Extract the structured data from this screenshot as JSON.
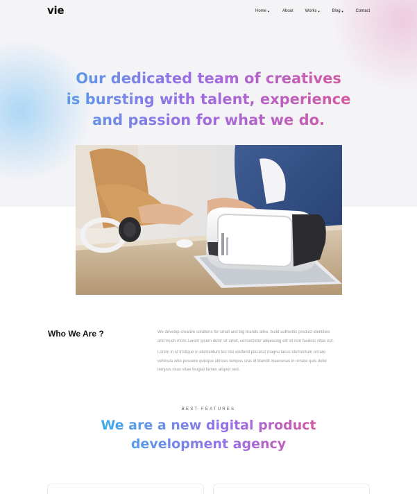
{
  "header": {
    "logo": "vie",
    "nav": [
      {
        "label": "Home",
        "has_dropdown": true
      },
      {
        "label": "About",
        "has_dropdown": false
      },
      {
        "label": "Works",
        "has_dropdown": true
      },
      {
        "label": "Blog",
        "has_dropdown": true
      },
      {
        "label": "Contact",
        "has_dropdown": false
      }
    ],
    "dropdown_caret": "▼"
  },
  "hero": {
    "title_lines": [
      "Our dedicated team of creatives",
      "is bursting with talent, experience",
      "and passion for what we do."
    ],
    "gradient_colors": [
      "#33b5e8",
      "#9a6ee6",
      "#ee4e86"
    ]
  },
  "about": {
    "heading": "Who We Are ?",
    "paragraph_1_lines": [
      "We develop creative solutions for small and big brands alike, build authentic product identities",
      "and much more.Lorem ipsum dolor sit amet, consectetur adipiscing elit sit non facilisis vitae eut."
    ],
    "paragraph_2_lines": [
      "Lorem in id tristique in elementum leo nisi eleifend placerat magna lacus elementum ornare",
      "vehicula odio posuere quisque ultrices tempus cras id blandit maecenas in ornare quis dolor",
      "tempus risus vitae feugiat fames aliquet sed."
    ]
  },
  "features": {
    "eyebrow": "BEST FEATURES",
    "title_lines": [
      "We are a new digital product",
      "development agency"
    ]
  }
}
